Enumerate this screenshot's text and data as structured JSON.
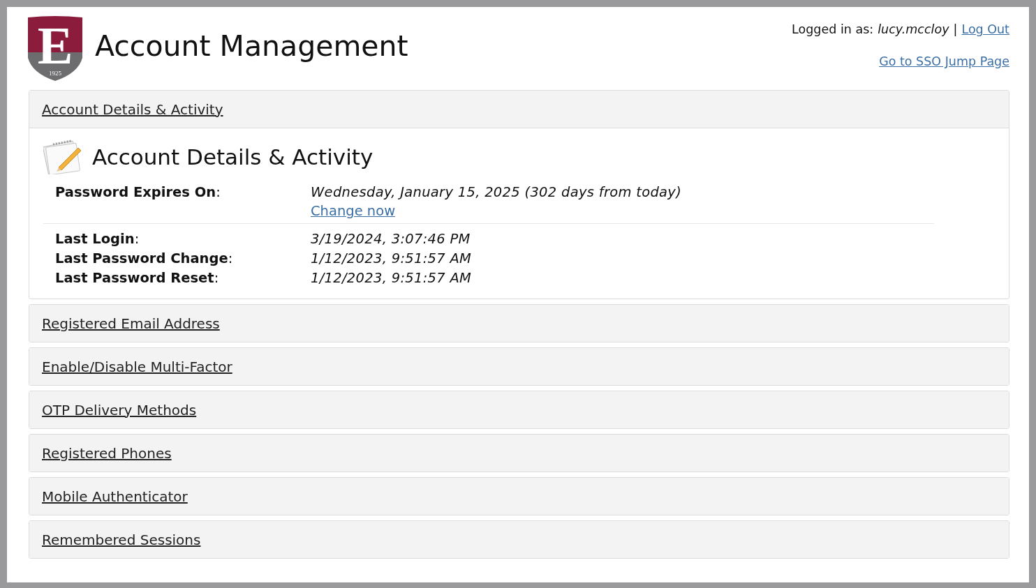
{
  "logo": {
    "letter": "E",
    "year": "1925"
  },
  "header": {
    "title": "Account Management",
    "logged_in_label": "Logged in as:",
    "username": "lucy.mccloy",
    "separator": "|",
    "logout": "Log Out",
    "sso_link": "Go to SSO Jump Page"
  },
  "sections": [
    {
      "title": "Account Details & Activity",
      "expanded": true,
      "heading": "Account Details & Activity",
      "groups": [
        [
          {
            "label": "**Password Expires On**:",
            "value": "Wednesday, January 15, 2025 (302 days from today)",
            "link": "Change now"
          }
        ],
        [
          {
            "label": "**Last Login**:",
            "value": "3/19/2024, 3:07:46 PM"
          },
          {
            "label": "**Last Password Change**:",
            "value": "1/12/2023, 9:51:57 AM"
          },
          {
            "label": "**Last Password Reset**:",
            "value": "1/12/2023, 9:51:57 AM"
          }
        ]
      ]
    },
    {
      "title": "Registered Email Address",
      "expanded": false
    },
    {
      "title": "Enable/Disable Multi-Factor",
      "expanded": false
    },
    {
      "title": "OTP Delivery Methods",
      "expanded": false
    },
    {
      "title": "Registered Phones",
      "expanded": false
    },
    {
      "title": "Mobile Authenticator",
      "expanded": false
    },
    {
      "title": "Remembered Sessions",
      "expanded": false
    }
  ]
}
